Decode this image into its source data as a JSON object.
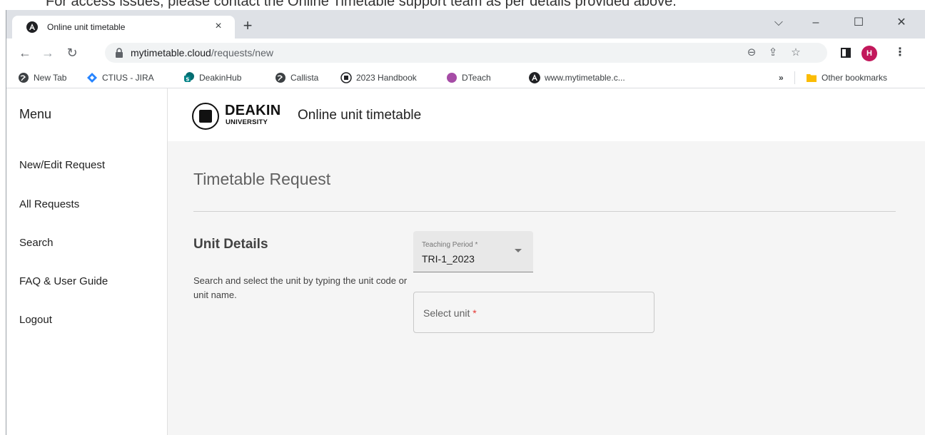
{
  "doc_strip": {
    "text": "For access issues, please contact the Online Timetable support team as per details provided above."
  },
  "browser": {
    "tab": {
      "title": "Online unit timetable",
      "close": "×",
      "favicon": "angular-icon"
    },
    "new_tab": "+",
    "window_controls": {
      "menu": "⌵",
      "minimize": "–",
      "maximize": "☐",
      "close": "✕"
    },
    "address": {
      "domain": "mytimetable.cloud",
      "path": "/requests/new"
    },
    "avatar_initial": "H",
    "bookmarks": [
      {
        "label": "New Tab",
        "icon": "globe-icon"
      },
      {
        "label": "CTIUS - JIRA",
        "icon": "jira-icon"
      },
      {
        "label": "DeakinHub",
        "icon": "sharepoint-icon"
      },
      {
        "label": "Callista",
        "icon": "globe-icon"
      },
      {
        "label": "2023 Handbook",
        "icon": "deakin-icon"
      },
      {
        "label": "DTeach",
        "icon": "dteach-icon"
      },
      {
        "label": "www.mytimetable.c...",
        "icon": "angular-icon"
      }
    ],
    "bookmarks_overflow": "»",
    "other_bookmarks": "Other bookmarks"
  },
  "sidebar": {
    "title": "Menu",
    "items": [
      {
        "label": "New/Edit Request"
      },
      {
        "label": "All Requests"
      },
      {
        "label": "Search"
      },
      {
        "label": "FAQ & User Guide"
      },
      {
        "label": "Logout"
      }
    ]
  },
  "header": {
    "logo_line1": "DEAKIN",
    "logo_line2": "UNIVERSITY",
    "title": "Online unit timetable"
  },
  "main": {
    "page_title": "Timetable Request",
    "section_title": "Unit Details",
    "section_desc": "Search and select the unit by typing the unit code or unit name.",
    "teaching_period": {
      "label": "Teaching Period *",
      "value": "TRI-1_2023"
    },
    "unit_select": {
      "placeholder": "Select unit",
      "required_mark": "*"
    }
  },
  "colors": {
    "avatar": "#c2185b",
    "jira": "#2684ff",
    "sharepoint": "#038387",
    "required": "#e53935",
    "content_bg": "#f5f5f5"
  }
}
